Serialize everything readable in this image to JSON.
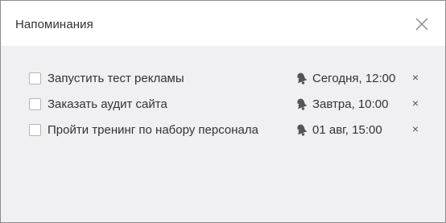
{
  "dialog": {
    "title": "Напоминания",
    "close_icon": "close-icon"
  },
  "reminders": [
    {
      "checked": false,
      "text": "Запустить тест рекламы",
      "time": "Сегодня, 12:00",
      "icon": "bell-icon",
      "remove_symbol": "×"
    },
    {
      "checked": false,
      "text": "Заказать аудит сайта",
      "time": "Завтра, 10:00",
      "icon": "bell-icon",
      "remove_symbol": "×"
    },
    {
      "checked": false,
      "text": "Пройти тренинг по набору персонала",
      "time": "01 авг, 15:00",
      "icon": "bell-icon",
      "remove_symbol": "×"
    }
  ],
  "colors": {
    "header_bg": "#ffffff",
    "body_bg": "#f0f0f2",
    "border": "#8c8c8c",
    "text": "#333333",
    "icon": "#555555"
  }
}
